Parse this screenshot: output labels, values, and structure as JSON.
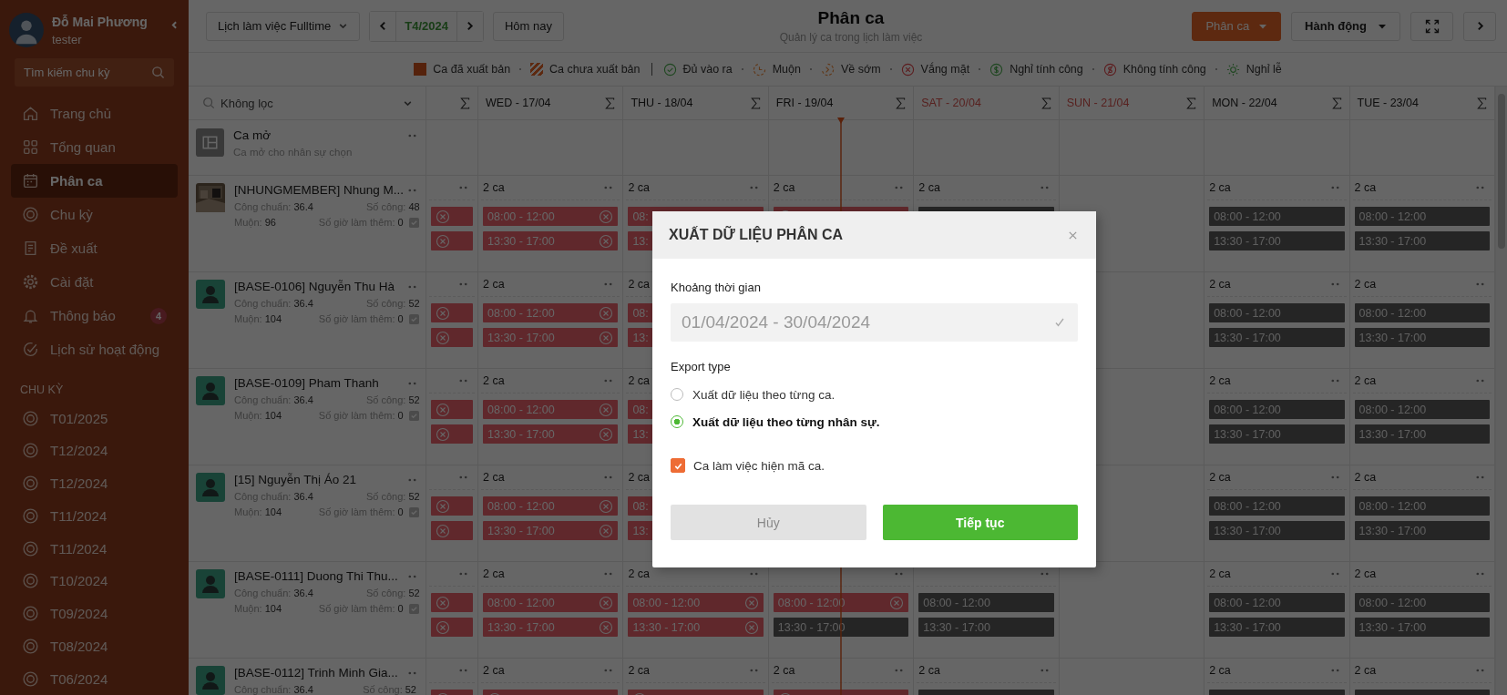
{
  "sidebar": {
    "user": {
      "name": "Đỗ Mai Phương",
      "role": "tester"
    },
    "search": {
      "placeholder": "Tìm kiếm chu kỳ"
    },
    "nav": [
      {
        "label": "Trang chủ",
        "selected": false
      },
      {
        "label": "Tổng quan",
        "selected": false
      },
      {
        "label": "Phân ca",
        "selected": true
      },
      {
        "label": "Chu kỳ",
        "selected": false
      },
      {
        "label": "Đề xuất",
        "selected": false
      },
      {
        "label": "Cài đặt",
        "selected": false
      },
      {
        "label": "Thông báo",
        "selected": false,
        "badge": "4"
      },
      {
        "label": "Lịch sử hoạt động",
        "selected": false
      }
    ],
    "section_title": "CHU KỲ",
    "cycles": [
      "T01/2025",
      "T12/2024",
      "T12/2024",
      "T11/2024",
      "T11/2024",
      "T10/2024",
      "T09/2024",
      "T08/2024",
      "T06/2024"
    ]
  },
  "toolbar": {
    "calendar_select": "Lịch làm việc Fulltime",
    "month": "T4/2024",
    "today_button": "Hôm nay",
    "title": "Phân ca",
    "subtitle": "Quản lý ca trong lịch làm việc",
    "primary_button": "Phân ca",
    "actions_button": "Hành động"
  },
  "legend": {
    "groups": [
      {
        "items": [
          {
            "label": "Ca đã xuất bản",
            "kind": "published"
          },
          {
            "label": "Ca chưa xuất bản",
            "kind": "unpublished"
          }
        ]
      },
      {
        "items": [
          {
            "label": "Đủ vào ra",
            "kind": "on-time"
          },
          {
            "label": "Muộn",
            "kind": "late"
          },
          {
            "label": "Về sớm",
            "kind": "early"
          },
          {
            "label": "Vắng mặt",
            "kind": "absent"
          },
          {
            "label": "Nghỉ tính công",
            "kind": "paid-leave"
          },
          {
            "label": "Không tính công",
            "kind": "unpaid-leave"
          },
          {
            "label": "Nghỉ lễ",
            "kind": "holiday"
          }
        ]
      }
    ]
  },
  "table": {
    "filter": "Không lọc",
    "days": [
      {
        "kind": "partial"
      },
      {
        "label": "WED - 17/04",
        "weekend": false
      },
      {
        "label": "THU - 18/04",
        "weekend": false
      },
      {
        "label": "FRI - 19/04",
        "weekend": false
      },
      {
        "label": "SAT - 20/04",
        "weekend": true
      },
      {
        "label": "SUN - 21/04",
        "weekend": true
      },
      {
        "label": "MON - 22/04",
        "weekend": false
      },
      {
        "label": "TUE - 23/04",
        "weekend": false
      }
    ],
    "open_shift": {
      "title": "Ca mở",
      "subtitle": "Ca mở cho nhân sự chọn"
    },
    "rows": [
      {
        "name": "[NHUNGMEMBER] Nhung M...",
        "kind": "picture",
        "stats": [
          "Công chuẩn: **36.4**",
          "Số công: **48**",
          "Muộn: **96**",
          "Số giờ làm thêm: **0**"
        ],
        "cells": [
          {
            "kind": "shifts",
            "shifts": [
              {
                "kind": "absent"
              },
              {
                "kind": "absent"
              }
            ]
          },
          {
            "kind": "shifts",
            "count": "2 ca",
            "shifts": [
              {
                "time": "08:00 - 12:00",
                "kind": "absent"
              },
              {
                "time": "13:30 - 17:00",
                "kind": "absent"
              }
            ]
          },
          {
            "kind": "clipped",
            "count": "2 ca",
            "shifts": [
              {
                "time": "08:",
                "kind": "absent"
              },
              {
                "time": "13:",
                "kind": "absent"
              }
            ]
          },
          {
            "kind": "shifts",
            "count": "2 ca",
            "shifts": [
              {
                "kind": "absent"
              }
            ]
          },
          {
            "kind": "shifts",
            "count": "2 ca",
            "shifts": [
              {
                "kind": "scheduled"
              }
            ]
          },
          {
            "kind": "empty"
          },
          {
            "kind": "shifts",
            "count": "2 ca",
            "shifts": [
              {
                "time": "08:00 - 12:00",
                "kind": "scheduled"
              },
              {
                "time": "13:30 - 17:00",
                "kind": "scheduled"
              }
            ]
          },
          {
            "kind": "shifts",
            "count": "2 ca",
            "shifts": [
              {
                "time": "08:00 - 12:00",
                "kind": "scheduled"
              },
              {
                "time": "13:30 - 17:00",
                "kind": "scheduled"
              }
            ]
          }
        ]
      },
      {
        "name": "[BASE-0106] Nguyễn Thu Hà",
        "kind": "default",
        "stats": [
          "Công chuẩn: **36.4**",
          "Số công: **52**",
          "Muộn: **104**",
          "Số giờ làm thêm: **0**"
        ],
        "cells": [
          {
            "kind": "shifts",
            "shifts": [
              {
                "kind": "absent"
              },
              {
                "kind": "absent"
              }
            ]
          },
          {
            "kind": "shifts",
            "count": "2 ca",
            "shifts": [
              {
                "time": "08:00 - 12:00",
                "kind": "absent"
              },
              {
                "time": "13:30 - 17:00",
                "kind": "absent"
              }
            ]
          },
          {
            "kind": "clipped",
            "count": "2 ca",
            "shifts": [
              {
                "time": "08:",
                "kind": "absent"
              },
              {
                "time": "13:",
                "kind": "absent"
              }
            ]
          },
          {
            "kind": "covered"
          },
          {
            "kind": "covered"
          },
          {
            "kind": "empty"
          },
          {
            "kind": "shifts",
            "count": "2 ca",
            "shifts": [
              {
                "time": "08:00 - 12:00",
                "kind": "scheduled"
              },
              {
                "time": "13:30 - 17:00",
                "kind": "scheduled"
              }
            ]
          },
          {
            "kind": "shifts",
            "count": "2 ca",
            "shifts": [
              {
                "time": "08:00 - 12:00",
                "kind": "scheduled"
              },
              {
                "time": "13:30 - 17:00",
                "kind": "scheduled"
              }
            ]
          }
        ]
      },
      {
        "name": "[BASE-0109] Pham Thanh",
        "kind": "default",
        "stats": [
          "Công chuẩn: **36.4**",
          "Số công: **52**",
          "Muộn: **104**",
          "Số giờ làm thêm: **0**"
        ],
        "cells": [
          {
            "kind": "shifts",
            "shifts": [
              {
                "kind": "absent"
              },
              {
                "kind": "absent"
              }
            ]
          },
          {
            "kind": "shifts",
            "count": "2 ca",
            "shifts": [
              {
                "time": "08:00 - 12:00",
                "kind": "absent"
              },
              {
                "time": "13:30 - 17:00",
                "kind": "absent"
              }
            ]
          },
          {
            "kind": "clipped",
            "count": "2 ca",
            "shifts": [
              {
                "time": "08:",
                "kind": "absent"
              },
              {
                "time": "13:",
                "kind": "absent"
              }
            ]
          },
          {
            "kind": "covered"
          },
          {
            "kind": "covered"
          },
          {
            "kind": "empty"
          },
          {
            "kind": "shifts",
            "count": "2 ca",
            "shifts": [
              {
                "time": "08:00 - 12:00",
                "kind": "scheduled"
              },
              {
                "time": "13:30 - 17:00",
                "kind": "scheduled"
              }
            ]
          },
          {
            "kind": "shifts",
            "count": "2 ca",
            "shifts": [
              {
                "time": "08:00 - 12:00",
                "kind": "scheduled"
              },
              {
                "time": "13:30 - 17:00",
                "kind": "scheduled"
              }
            ]
          }
        ]
      },
      {
        "name": "[15] Nguyễn Thị Áo 21",
        "kind": "default",
        "stats": [
          "Công chuẩn: **36.4**",
          "Số công: **52**",
          "Muộn: **104**",
          "Số giờ làm thêm: **0**"
        ],
        "cells": [
          {
            "kind": "shifts",
            "shifts": [
              {
                "kind": "absent"
              },
              {
                "kind": "absent"
              }
            ]
          },
          {
            "kind": "shifts",
            "count": "2 ca",
            "shifts": [
              {
                "time": "08:00 - 12:00",
                "kind": "absent"
              },
              {
                "time": "13:30 - 17:00",
                "kind": "absent"
              }
            ]
          },
          {
            "kind": "clipped",
            "count": "2 ca",
            "shifts": [
              {
                "time": "08:",
                "kind": "absent"
              },
              {
                "time": "13:",
                "kind": "absent"
              }
            ]
          },
          {
            "kind": "covered"
          },
          {
            "kind": "covered"
          },
          {
            "kind": "empty"
          },
          {
            "kind": "shifts",
            "count": "2 ca",
            "shifts": [
              {
                "time": "08:00 - 12:00",
                "kind": "scheduled"
              },
              {
                "time": "13:30 - 17:00",
                "kind": "scheduled"
              }
            ]
          },
          {
            "kind": "shifts",
            "count": "2 ca",
            "shifts": [
              {
                "time": "08:00 - 12:00",
                "kind": "scheduled"
              },
              {
                "time": "13:30 - 17:00",
                "kind": "scheduled"
              }
            ]
          }
        ]
      },
      {
        "name": "[BASE-0111] Duong Thi Thu...",
        "kind": "default",
        "stats": [
          "Công chuẩn: **36.4**",
          "Số công: **52**",
          "Muộn: **104**",
          "Số giờ làm thêm: **0**"
        ],
        "cells": [
          {
            "kind": "shifts",
            "shifts": [
              {
                "kind": "absent"
              },
              {
                "kind": "absent"
              }
            ]
          },
          {
            "kind": "shifts",
            "count": "2 ca",
            "shifts": [
              {
                "time": "08:00 - 12:00",
                "kind": "absent"
              },
              {
                "time": "13:30 - 17:00",
                "kind": "absent"
              }
            ]
          },
          {
            "kind": "shifts",
            "count": "2 ca",
            "shifts": [
              {
                "time": "08:00 - 12:00",
                "kind": "absent"
              },
              {
                "time": "13:30 - 17:00",
                "kind": "absent"
              }
            ]
          },
          {
            "kind": "shifts",
            "shifts": [
              {
                "time": "08:00 - 12:00",
                "kind": "absent"
              },
              {
                "time": "13:30 - 17:00",
                "kind": "scheduled"
              }
            ]
          },
          {
            "kind": "shifts",
            "shifts": [
              {
                "time": "08:00 - 12:00",
                "kind": "scheduled"
              },
              {
                "time": "13:30 - 17:00",
                "kind": "scheduled"
              }
            ]
          },
          {
            "kind": "empty"
          },
          {
            "kind": "shifts",
            "count": "2 ca",
            "shifts": [
              {
                "time": "08:00 - 12:00",
                "kind": "scheduled"
              },
              {
                "time": "13:30 - 17:00",
                "kind": "scheduled"
              }
            ]
          },
          {
            "kind": "shifts",
            "count": "2 ca",
            "shifts": [
              {
                "time": "08:00 - 12:00",
                "kind": "scheduled"
              },
              {
                "time": "13:30 - 17:00",
                "kind": "scheduled"
              }
            ]
          }
        ]
      },
      {
        "name": "[BASE-0112] Trinh Minh Gia...",
        "kind": "default",
        "stats": [
          "Công chuẩn: **36.4**",
          "Số công: **52**"
        ],
        "cells": [
          {
            "kind": "shifts",
            "shifts": [
              {
                "kind": "absent"
              }
            ]
          },
          {
            "kind": "shifts",
            "count": "2 ca",
            "shifts": [
              {
                "kind": "absent"
              }
            ]
          },
          {
            "kind": "shifts",
            "count": "2 ca",
            "shifts": [
              {
                "kind": "absent"
              }
            ]
          },
          {
            "kind": "shifts",
            "count": "2 ca",
            "shifts": [
              {
                "kind": "absent"
              }
            ]
          },
          {
            "kind": "shifts",
            "count": "2 ca",
            "shifts": [
              {
                "kind": "scheduled"
              }
            ]
          },
          {
            "kind": "empty"
          },
          {
            "kind": "shifts",
            "count": "2 ca",
            "shifts": [
              {
                "kind": "scheduled"
              }
            ]
          },
          {
            "kind": "shifts",
            "count": "2 ca",
            "shifts": [
              {
                "kind": "scheduled"
              }
            ]
          }
        ]
      }
    ]
  },
  "dialog": {
    "title": "XUẤT DỮ LIỆU PHÂN CA",
    "range": {
      "label": "Khoảng thời gian",
      "value": "01/04/2024 - 30/04/2024"
    },
    "export_type": {
      "label": "Export type",
      "options": [
        {
          "label": "Xuất dữ liệu theo từng ca.",
          "selected": false
        },
        {
          "label": "Xuất dữ liệu theo từng nhân sự.",
          "selected": true
        }
      ]
    },
    "show_code": {
      "label": "Ca làm việc hiện mã ca.",
      "checked": true
    },
    "buttons": [
      {
        "label": "Hủy",
        "kind": "secondary"
      },
      {
        "label": "Tiếp tục",
        "kind": "primary"
      }
    ]
  }
}
